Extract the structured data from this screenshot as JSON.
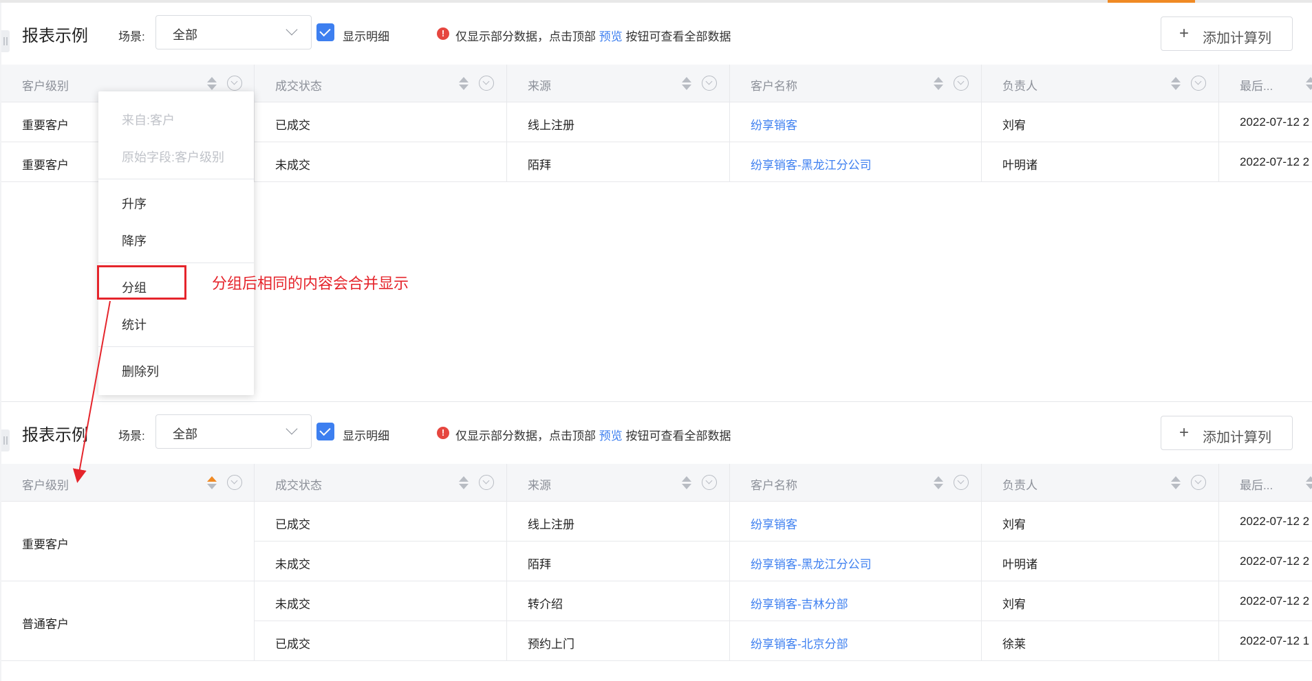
{
  "report": {
    "title": "报表示例",
    "scene_label": "场景:",
    "scene_value": "全部",
    "show_detail_label": "显示明细",
    "notice_prefix": "仅显示部分数据，点击顶部",
    "notice_link": "预览",
    "notice_suffix": "按钮可查看全部数据",
    "add_button_label": "添加计算列"
  },
  "columns": [
    "客户级别",
    "成交状态",
    "来源",
    "客户名称",
    "负责人",
    "最后..."
  ],
  "table1": {
    "rows": [
      {
        "level": "重要客户",
        "status": "已成交",
        "source": "线上注册",
        "customer": "纷享销客",
        "owner": "刘宥",
        "last": "2022-07-12 2"
      },
      {
        "level": "重要客户",
        "status": "未成交",
        "source": "陌拜",
        "customer": "纷享销客-黑龙江分公司",
        "owner": "叶明诸",
        "last": "2022-07-12 2"
      }
    ]
  },
  "context_menu": {
    "from": "来自:客户",
    "origin_field": "原始字段:客户级别",
    "sort_asc": "升序",
    "sort_desc": "降序",
    "group": "分组",
    "stats": "统计",
    "delete_col": "删除列"
  },
  "annotation": "分组后相同的内容会合并显示",
  "table2": {
    "groups": [
      {
        "level": "重要客户",
        "rows": [
          {
            "status": "已成交",
            "source": "线上注册",
            "customer": "纷享销客",
            "owner": "刘宥",
            "last": "2022-07-12 2"
          },
          {
            "status": "未成交",
            "source": "陌拜",
            "customer": "纷享销客-黑龙江分公司",
            "owner": "叶明诸",
            "last": "2022-07-12 2"
          }
        ]
      },
      {
        "level": "普通客户",
        "rows": [
          {
            "status": "未成交",
            "source": "转介绍",
            "customer": "纷享销客-吉林分部",
            "owner": "刘宥",
            "last": "2022-07-12 2"
          },
          {
            "status": "已成交",
            "source": "预约上门",
            "customer": "纷享销客-北京分部",
            "owner": "徐莱",
            "last": "2022-07-12 1"
          }
        ]
      }
    ]
  },
  "colors": {
    "accent": "#3d7ff0",
    "annotation": "#e5242b",
    "sort_active": "#f08a24"
  }
}
